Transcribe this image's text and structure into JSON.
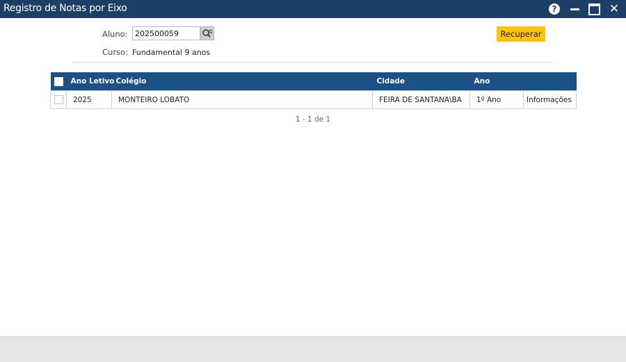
{
  "window": {
    "title": "Registro de Notas por Eixo",
    "help_symbol": "?",
    "close_symbol": "✕"
  },
  "form": {
    "aluno_label": "Aluno:",
    "aluno_value": "202500059",
    "curso_label": "Curso:",
    "curso_value": "Fundamental 9 anos",
    "lookup_icon": "search-list-icon",
    "recuperar_label": "Recuperar"
  },
  "grid": {
    "columns": [
      "Ano Letivo",
      "Colégio",
      "Cidade",
      "Ano"
    ],
    "rows": [
      {
        "ano_letivo": "2025",
        "colegio": "MONTEIRO LOBATO",
        "cidade": "FEIRA DE SANTANA\\BA",
        "ano": "1º Ano",
        "link": "Informações"
      }
    ]
  },
  "pager": "1 - 1 de 1",
  "colors": {
    "titlebar": "#1c3f66",
    "grid_header": "#1c5186",
    "button": "#ffc20e",
    "link": "#1e5f9a"
  }
}
